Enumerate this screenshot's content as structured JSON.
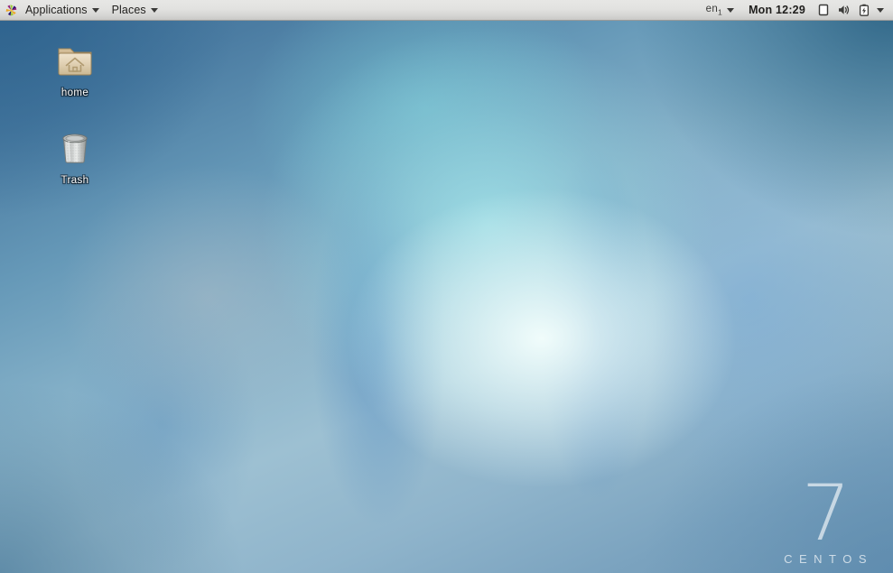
{
  "panel": {
    "logo_icon": "centos-pinwheel-icon",
    "menus": [
      {
        "label": "Applications",
        "caret_icon": "chevron-down-icon"
      },
      {
        "label": "Places",
        "caret_icon": "chevron-down-icon"
      }
    ],
    "keyboard": {
      "label": "en",
      "sub": "1",
      "caret_icon": "chevron-down-icon"
    },
    "clock": "Mon 12:29",
    "status_icons": [
      {
        "name": "display-icon",
        "title": "Display"
      },
      {
        "name": "volume-icon",
        "title": "Volume"
      },
      {
        "name": "battery-charging-icon",
        "title": "Battery"
      },
      {
        "name": "chevron-down-icon",
        "title": "System menu"
      }
    ],
    "colors": {
      "background_top": "#e7e7e5",
      "background_bottom": "#c9c9c7",
      "text": "#22211f"
    }
  },
  "desktop": {
    "icons": [
      {
        "name": "home-folder",
        "label": "home",
        "icon": "folder-home-icon"
      },
      {
        "name": "trash",
        "label": "Trash",
        "icon": "trash-can-icon"
      }
    ],
    "watermark": {
      "version": "7",
      "brand": "CENTOS"
    },
    "colors": {
      "wallpaper_dark_blue": "#3f6f96",
      "wallpaper_mid_blue": "#6699b8",
      "wallpaper_light": "#e8fafa",
      "accent_cyan": "#8fd8de",
      "label_text": "#ffffff"
    }
  }
}
